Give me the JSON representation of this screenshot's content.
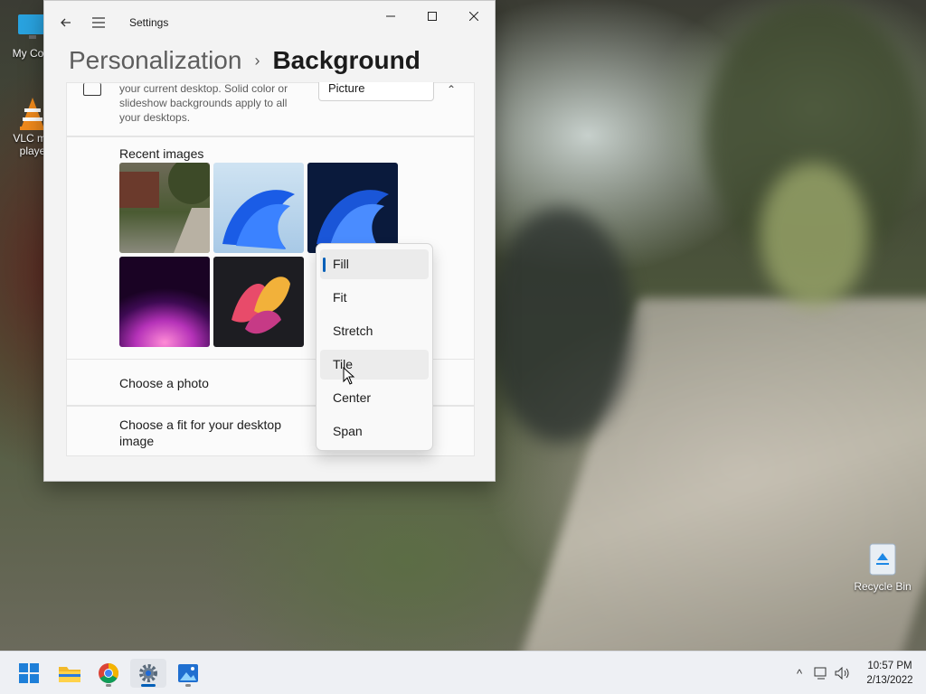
{
  "desktop": {
    "icons": [
      {
        "label": "My Com"
      },
      {
        "label": "VLC me"
      },
      {
        "label": "playe"
      }
    ],
    "recycle_label": "Recycle Bin"
  },
  "window": {
    "app_title": "Settings",
    "breadcrumb": {
      "parent": "Personalization",
      "separator": "›",
      "current": "Background"
    },
    "background_card": {
      "description": "your current desktop. Solid color or slideshow backgrounds apply to all your desktops.",
      "picture_value": "Picture"
    },
    "recent_images_label": "Recent images",
    "choose_photo_label": "Choose a photo",
    "choose_fit_label": "Choose a fit for your desktop image"
  },
  "fit_dropdown": {
    "options": [
      "Fill",
      "Fit",
      "Stretch",
      "Tile",
      "Center",
      "Span"
    ],
    "selected": "Fill",
    "hovered": "Tile"
  },
  "taskbar": {
    "time": "10:57 PM",
    "date": "2/13/2022",
    "apps": [
      "start",
      "file-explorer",
      "chrome",
      "settings",
      "photos"
    ]
  },
  "colors": {
    "accent": "#005fb8",
    "window_bg": "#f3f3f3",
    "card_bg": "#fbfbfb"
  }
}
